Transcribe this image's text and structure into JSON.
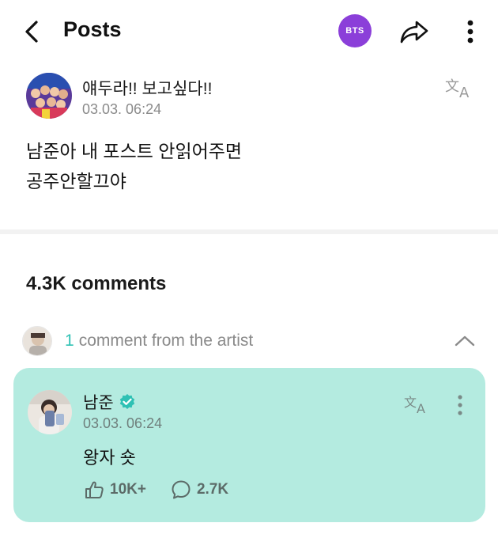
{
  "header": {
    "title": "Posts",
    "community_badge": "BTS",
    "badge_color": "#8b3fd9"
  },
  "post": {
    "author": "얘두라!! 보고싶다!!",
    "timestamp": "03.03. 06:24",
    "body_lines": [
      "남준아 내 포스트 안읽어주면",
      "공주안할끄야"
    ]
  },
  "comments": {
    "count_label": "4.3K comments",
    "artist_row": {
      "count": "1",
      "label": "comment from the artist"
    }
  },
  "artist_comment": {
    "name": "남준",
    "timestamp": "03.03. 06:24",
    "text": "왕자 숏",
    "likes": "10K+",
    "replies": "2.7K",
    "card_color": "#b4ebe0",
    "verified_color": "#2fc1b4"
  },
  "icons": {
    "back": "chevron-left-icon",
    "share": "share-arrow-icon",
    "more": "more-vertical-icon",
    "translate": "translate-icon",
    "collapse": "chevron-up-icon",
    "verified": "verified-badge-icon",
    "like": "like-icon",
    "reply": "comment-bubble-icon"
  }
}
